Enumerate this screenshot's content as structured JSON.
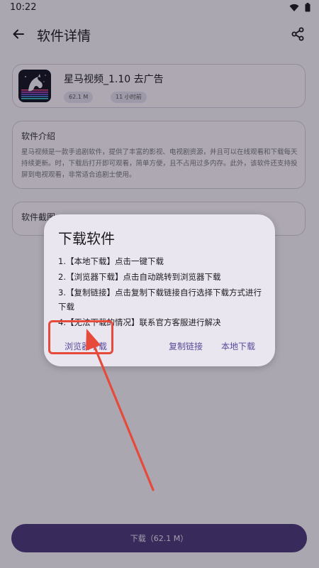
{
  "status_bar": {
    "time": "10:22"
  },
  "header": {
    "title": "软件详情"
  },
  "app": {
    "name": "星马视频_1.10 去广告",
    "size": "62.1 M",
    "updated": "11 小时前"
  },
  "intro": {
    "title": "软件介绍",
    "text": "星马视频是一款手追剧软件，提供了丰富的影视、电视剧资源，并且可以在线观看和下载每天持续更新。时，下载后打开即可观看，简单方便，且不占用过多内存。此外，该软件还支持投屏到电视观看，非常适合追剧士使用。"
  },
  "screenshots": {
    "title": "软件截图"
  },
  "download_bar": {
    "label": "下载（62.1 M）"
  },
  "dialog": {
    "title": "下载软件",
    "items": [
      "1.【本地下载】点击一键下载",
      "2.【浏览器下载】点击自动跳转到浏览器下载",
      "3.【复制链接】点击复制下载链接自行选择下载方式进行下载",
      "4.【无法下载的情况】联系官方客服进行解决"
    ],
    "buttons": {
      "browser": "浏览器下载",
      "copy": "复制链接",
      "local": "本地下载"
    }
  },
  "colors": {
    "accent": "#5a4b99",
    "download_bar": "#4a3a78",
    "annotation": "#e54a3a"
  },
  "icons": [
    "back-arrow-icon",
    "share-icon",
    "wifi-icon",
    "battery-icon"
  ]
}
